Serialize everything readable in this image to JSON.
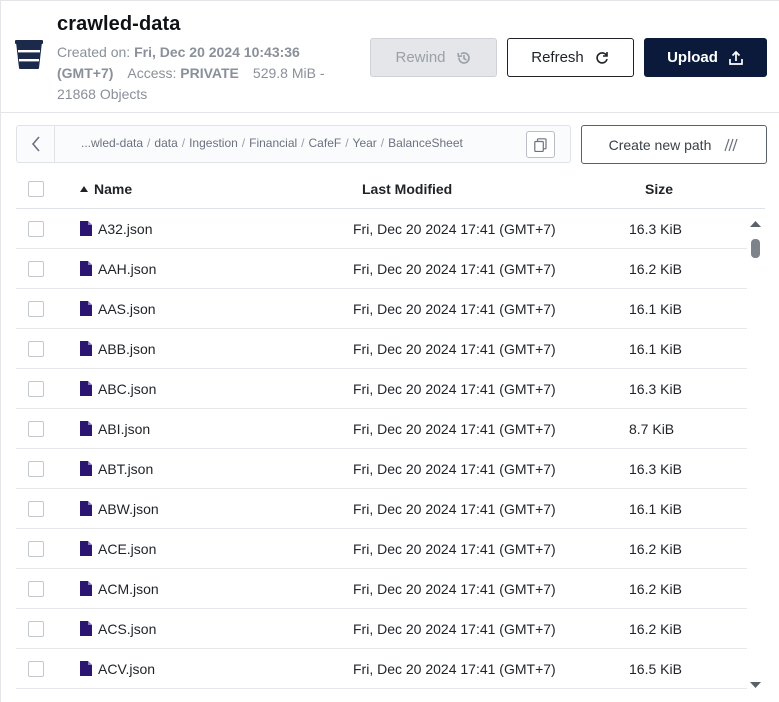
{
  "bucket": {
    "icon": "bucket-icon",
    "name": "crawled-data",
    "created_label": "Created on:",
    "created_value": "Fri, Dec 20 2024 10:43:36 (GMT+7)",
    "access_label": "Access:",
    "access_value": "PRIVATE",
    "size": "529.8 MiB -",
    "objects": "21868 Objects"
  },
  "toolbar": {
    "rewind_label": "Rewind",
    "rewind_icon": "history-icon",
    "refresh_label": "Refresh",
    "refresh_icon": "refresh-icon",
    "upload_label": "Upload",
    "upload_icon": "upload-icon"
  },
  "breadcrumb": {
    "back_icon": "chevron-left-icon",
    "segments": [
      "...wled-data",
      "data",
      "Ingestion",
      "Financial",
      "CafeF",
      "Year",
      "BalanceSheet"
    ],
    "separator": "/",
    "copy_icon": "copy-icon",
    "create_path_label": "Create new path",
    "create_path_icon": "new-path-icon"
  },
  "table": {
    "columns": {
      "name": "Name",
      "modified": "Last Modified",
      "size": "Size"
    },
    "sort_icon": "sort-asc-icon",
    "rows": [
      {
        "name": "A32.json",
        "modified": "Fri, Dec 20 2024 17:41 (GMT+7)",
        "size": "16.3 KiB"
      },
      {
        "name": "AAH.json",
        "modified": "Fri, Dec 20 2024 17:41 (GMT+7)",
        "size": "16.2 KiB"
      },
      {
        "name": "AAS.json",
        "modified": "Fri, Dec 20 2024 17:41 (GMT+7)",
        "size": "16.1 KiB"
      },
      {
        "name": "ABB.json",
        "modified": "Fri, Dec 20 2024 17:41 (GMT+7)",
        "size": "16.1 KiB"
      },
      {
        "name": "ABC.json",
        "modified": "Fri, Dec 20 2024 17:41 (GMT+7)",
        "size": "16.3 KiB"
      },
      {
        "name": "ABI.json",
        "modified": "Fri, Dec 20 2024 17:41 (GMT+7)",
        "size": "8.7 KiB"
      },
      {
        "name": "ABT.json",
        "modified": "Fri, Dec 20 2024 17:41 (GMT+7)",
        "size": "16.3 KiB"
      },
      {
        "name": "ABW.json",
        "modified": "Fri, Dec 20 2024 17:41 (GMT+7)",
        "size": "16.1 KiB"
      },
      {
        "name": "ACE.json",
        "modified": "Fri, Dec 20 2024 17:41 (GMT+7)",
        "size": "16.2 KiB"
      },
      {
        "name": "ACM.json",
        "modified": "Fri, Dec 20 2024 17:41 (GMT+7)",
        "size": "16.2 KiB"
      },
      {
        "name": "ACS.json",
        "modified": "Fri, Dec 20 2024 17:41 (GMT+7)",
        "size": "16.2 KiB"
      },
      {
        "name": "ACV.json",
        "modified": "Fri, Dec 20 2024 17:41 (GMT+7)",
        "size": "16.5 KiB"
      }
    ]
  },
  "colors": {
    "brand_dark": "#0b1a3a",
    "file_icon": "#2a1670",
    "muted_text": "#8a9099"
  }
}
